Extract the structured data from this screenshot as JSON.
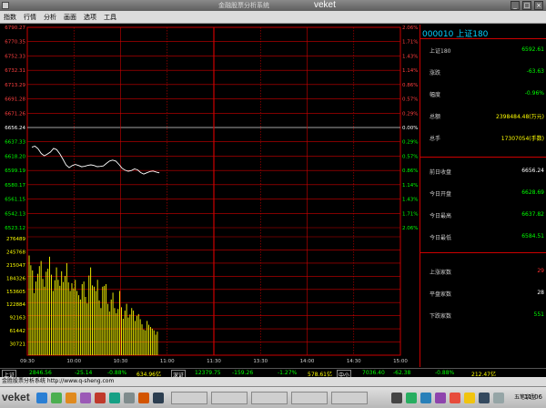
{
  "window": {
    "title": "金融股票分析系统",
    "brand": "veket",
    "buttons": [
      "_",
      "□",
      "×"
    ]
  },
  "menu": [
    "指数",
    "行情",
    "分析",
    "画面",
    "选项",
    "工具"
  ],
  "chart_data": {
    "type": "line",
    "x_ticks": [
      "09:30",
      "10:00",
      "10:30",
      "11:00",
      "11:30",
      "13:30",
      "14:00",
      "14:30",
      "15:00"
    ],
    "price_ticks_left": [
      "6790.27",
      "6770.35",
      "6752.33",
      "6732.31",
      "6713.29",
      "6691.28",
      "6671.26",
      "6656.24",
      "6637.33",
      "6618.20",
      "6599.19",
      "6580.17",
      "6561.15",
      "6542.13",
      "6523.12"
    ],
    "pct_ticks_right": [
      "2.06%",
      "1.71%",
      "1.43%",
      "1.14%",
      "0.86%",
      "0.57%",
      "0.29%",
      "0.00%",
      "0.29%",
      "0.57%",
      "0.86%",
      "1.14%",
      "1.43%",
      "1.71%",
      "2.06%"
    ],
    "volume_ticks_left": [
      "276489",
      "245768",
      "215047",
      "184326",
      "153605",
      "122884",
      "92163",
      "61442",
      "30721"
    ],
    "price_series": [
      6630.5,
      6631.8,
      6628.4,
      6622.1,
      6618.9,
      6621.3,
      6624.0,
      6628.9,
      6627.2,
      6621.5,
      6614.3,
      6606.8,
      6603.2,
      6605.9,
      6607.4,
      6606.1,
      6604.3,
      6605.0,
      6606.2,
      6606.9,
      6606.0,
      6604.5,
      6604.8,
      6605.4,
      6608.8,
      6612.0,
      6613.2,
      6611.9,
      6607.5,
      6602.4,
      6599.8,
      6598.4,
      6599.2,
      6601.5,
      6600.2,
      6596.6,
      6594.7,
      6596.3,
      6598.0,
      6598.7,
      6597.3,
      6596.2
    ],
    "volume_series": [
      233000,
      210000,
      198000,
      145000,
      172000,
      190000,
      208000,
      220000,
      178000,
      160000,
      195000,
      202000,
      230000,
      188000,
      150000,
      175000,
      205000,
      176000,
      162000,
      196000,
      171000,
      185000,
      215000,
      170000,
      150000,
      168000,
      156000,
      176000,
      150000,
      140000,
      130000,
      166000,
      172000,
      136000,
      121000,
      186000,
      205000,
      163000,
      160000,
      150000,
      176000,
      128000,
      110000,
      160000,
      162000,
      166000,
      120000,
      102000,
      130000,
      146000,
      110000,
      98000,
      108000,
      150000,
      112000,
      85000,
      104000,
      120000,
      88000,
      95000,
      110000,
      104000,
      80000,
      92000,
      96000,
      84000,
      72000,
      60000,
      58000,
      80000,
      71000,
      66000,
      62000,
      58000,
      48000,
      55000
    ]
  },
  "panel": {
    "title": "000010 上证180",
    "rows1": [
      {
        "label": "上证180",
        "value": "6592.61",
        "color": "#00ff00"
      },
      {
        "label": "涨跌",
        "value": "-63.63",
        "color": "#00ff00"
      },
      {
        "label": "幅度",
        "value": "-0.96%",
        "color": "#00ff00"
      },
      {
        "label": "总额",
        "value": "2398484.48(万元)",
        "color": "#ffff00"
      },
      {
        "label": "总手",
        "value": "17307054(手数)",
        "color": "#ffff00"
      }
    ],
    "rows2": [
      {
        "label": "前日收盘",
        "value": "6656.24",
        "color": "#ffffff"
      },
      {
        "label": "今日开盘",
        "value": "6628.69",
        "color": "#00ff00"
      },
      {
        "label": "今日最高",
        "value": "6637.82",
        "color": "#00ff00"
      },
      {
        "label": "今日最低",
        "value": "6584.51",
        "color": "#00ff00"
      }
    ],
    "rows3": [
      {
        "label": "上涨家数",
        "value": "29",
        "color": "#ff3030"
      },
      {
        "label": "平盘家数",
        "value": "28",
        "color": "#ffffff"
      },
      {
        "label": "下跌家数",
        "value": "551",
        "color": "#00ff00"
      }
    ]
  },
  "ticker": {
    "items": [
      {
        "text": "上证",
        "box": true,
        "color": "#fff"
      },
      {
        "text": "2846.56",
        "color": "#00ff00"
      },
      {
        "text": "-25.14",
        "color": "#00ff00"
      },
      {
        "text": "-0.88%",
        "color": "#00ff00"
      },
      {
        "text": "634.96亿",
        "color": "#ffff00"
      },
      {
        "text": "深证",
        "box": true,
        "color": "#fff"
      },
      {
        "text": "12379.75",
        "color": "#00ff00"
      },
      {
        "text": "-159.26",
        "color": "#00ff00"
      },
      {
        "text": "-1.27%",
        "color": "#00ff00"
      },
      {
        "text": "578.61亿",
        "color": "#ffff00"
      },
      {
        "text": "中小",
        "box": true,
        "color": "#fff"
      },
      {
        "text": "7036.40",
        "color": "#00ff00"
      },
      {
        "text": "-62.38",
        "color": "#00ff00"
      },
      {
        "text": "-0.88%",
        "color": "#00ff00"
      },
      {
        "text": "212.47亿",
        "color": "#ffff00"
      }
    ]
  },
  "statusbar": {
    "text": "金胜股票分析系统 http://www.q-sheng.com"
  },
  "taskbar": {
    "start": "veket",
    "ime": "五笔字型",
    "clock": "11:06"
  }
}
